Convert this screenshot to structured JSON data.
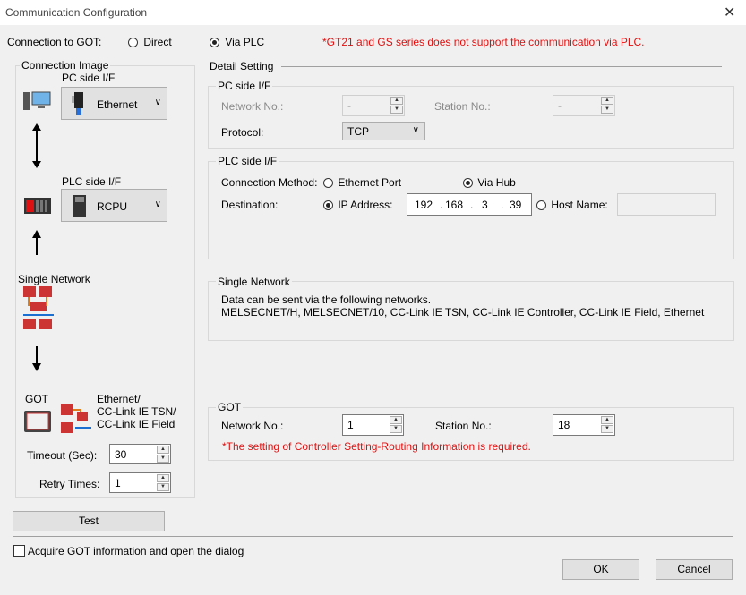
{
  "window": {
    "title": "Communication Configuration",
    "close": "✕"
  },
  "connection": {
    "label": "Connection to GOT:",
    "direct": "Direct",
    "via_plc": "Via PLC",
    "note": "*GT21 and GS series does not support the communication via PLC."
  },
  "image": {
    "title": "Connection Image",
    "pc_if_label": "PC side I/F",
    "pc_if_value": "Ethernet",
    "plc_if_label": "PLC side I/F",
    "plc_if_value": "RCPU",
    "single_network": "Single Network",
    "got": "GOT",
    "got_net_1": "Ethernet/",
    "got_net_2": "CC-Link IE TSN/",
    "got_net_3": "CC-Link IE Field",
    "timeout_label": "Timeout (Sec):",
    "timeout_value": "30",
    "retry_label": "Retry Times:",
    "retry_value": "1"
  },
  "detail": {
    "title": "Detail Setting",
    "pc_side": {
      "title": "PC side I/F",
      "network_label": "Network No.:",
      "network_value": "-",
      "station_label": "Station No.:",
      "station_value": "-",
      "protocol_label": "Protocol:",
      "protocol_value": "TCP"
    },
    "plc_side": {
      "title": "PLC side I/F",
      "method_label": "Connection Method:",
      "ethernet_port": "Ethernet Port",
      "via_hub": "Via Hub",
      "destination_label": "Destination:",
      "ip_label": "IP Address:",
      "ip": [
        "192",
        "168",
        "3",
        "39"
      ],
      "ip_dot": ".",
      "host_label": "Host Name:",
      "host_value": ""
    },
    "single_network": {
      "title": "Single Network",
      "line1": "Data can be sent via the following networks.",
      "line2": "MELSECNET/H, MELSECNET/10, CC-Link IE TSN, CC-Link IE Controller, CC-Link IE Field, Ethernet"
    },
    "got": {
      "title": "GOT",
      "network_label": "Network No.:",
      "network_value": "1",
      "station_label": "Station No.:",
      "station_value": "18",
      "note": "*The setting of Controller Setting-Routing Information is required."
    }
  },
  "footer": {
    "test": "Test",
    "acquire": "Acquire GOT information and open the dialog",
    "ok": "OK",
    "cancel": "Cancel"
  },
  "colors": {
    "accent_red": "#e01010",
    "disabled_gray": "#8a8a8a"
  }
}
